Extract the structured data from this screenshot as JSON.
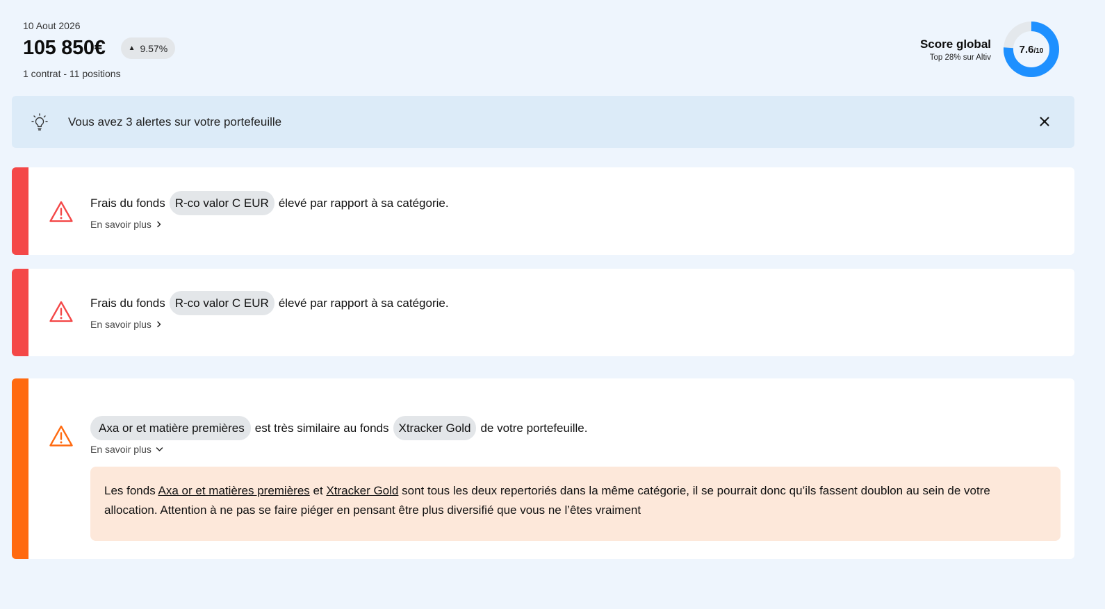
{
  "summary": {
    "date": "10 Aout 2026",
    "amount": "105 850€",
    "performance": "9.57%",
    "positions": "1 contrat - 11 positions"
  },
  "score": {
    "title": "Score global",
    "subtitle": "Top 28% sur Altiv",
    "value": "7.6",
    "suffix": "/10",
    "fraction": 0.76,
    "color": "#1e90ff",
    "track_color": "#e4e8ec"
  },
  "banner": {
    "text": "Vous avez 3 alertes sur votre portefeuille",
    "icon": "lightbulb-icon",
    "close_icon": "close-icon"
  },
  "alerts": [
    {
      "severity": "high",
      "color": "#f44848",
      "prefix": "Frais du fonds",
      "fund": "R-co valor C EUR",
      "suffix": "élevé par rapport à sa catégorie.",
      "more": "En savoir plus"
    },
    {
      "severity": "high",
      "color": "#f44848",
      "prefix": "Frais du fonds",
      "fund": "R-co valor C EUR",
      "suffix": "élevé par rapport à sa catégorie.",
      "more": "En savoir plus"
    },
    {
      "severity": "medium",
      "color": "#ff6a10",
      "fund_a": "Axa or et matière premières",
      "middle": "est très similaire au fonds",
      "fund_b": "Xtracker Gold",
      "suffix": "de votre portefeuille.",
      "more": "En savoir plus",
      "detail": {
        "t1": "Les fonds",
        "link1": "Axa or et matières premières",
        "t2": "et",
        "link2": "Xtracker Gold",
        "t3": "sont tous les deux repertoriés dans la même catégorie, il se pourrait donc qu’ils fassent doublon au sein de votre allocation. Attention à ne pas se faire piéger en pensant être plus diversifié que vous ne l’êtes vraiment"
      }
    }
  ]
}
